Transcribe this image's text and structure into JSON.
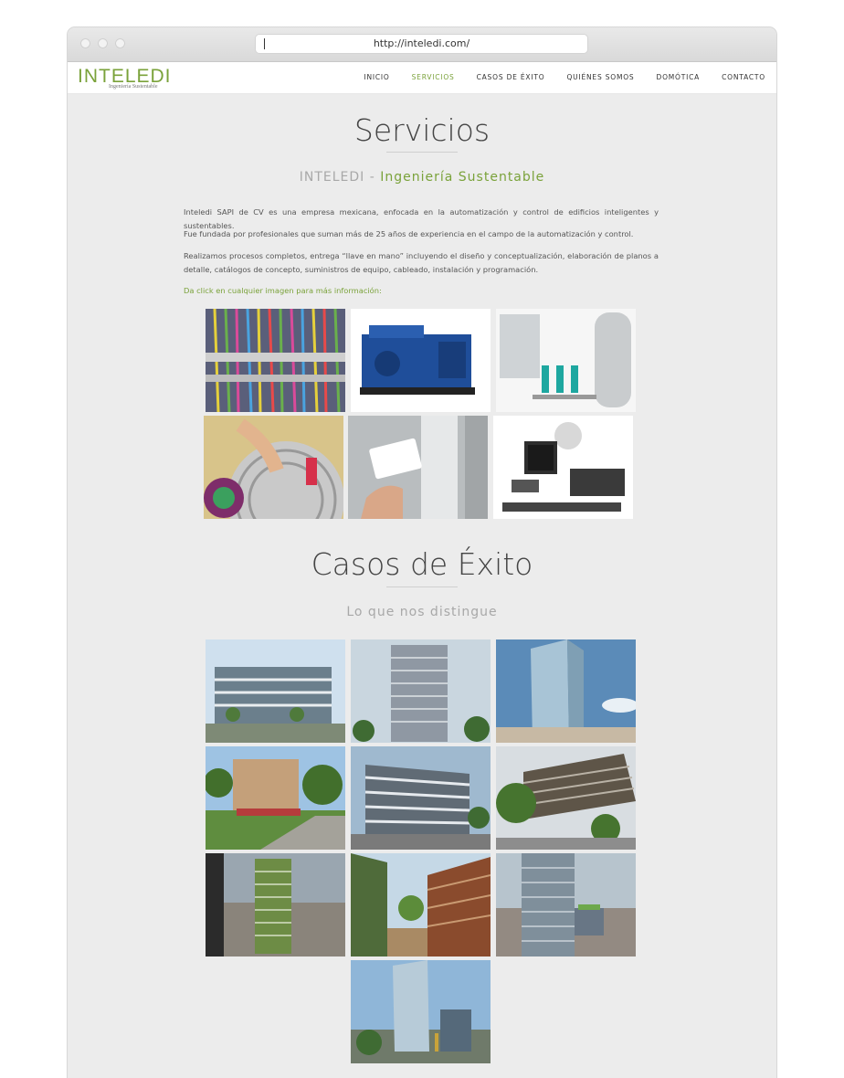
{
  "browser": {
    "url": "http://inteledi.com/"
  },
  "header": {
    "logo": "INTELEDI",
    "logo_tagline": "Ingeniería Sustentable",
    "menu": [
      "INICIO",
      "SERVICIOS",
      "CASOS DE ÉXITO",
      "QUIÉNES SOMOS",
      "DOMÓTICA",
      "CONTACTO"
    ],
    "active_menu": "SERVICIOS"
  },
  "servicios": {
    "title": "Servicios",
    "subtitle_gray": "INTELEDI -",
    "subtitle_green": "Ingeniería Sustentable",
    "paragraphs": [
      "Inteledi SAPI de CV es una empresa mexicana, enfocada en la automatización y control de edificios inteligentes y sustentables.",
      "Fue fundada por profesionales que suman más de 25 años de experiencia en el campo de la automatización y control.",
      "Realizamos procesos completos, entrega “llave en mano” incluyendo el diseño y conceptualización, elaboración de planos a detalle, catálogos de concepto, suministros de equipo, cableado, instalación y programación."
    ],
    "hint": "Da click en cualquier imagen para más información:",
    "images": [
      "network-cabling",
      "power-generator",
      "water-pump-system",
      "hvac-service",
      "access-card-reader",
      "security-camera-system"
    ]
  },
  "casos": {
    "title": "Casos de Éxito",
    "subtitle": "Lo que nos distingue",
    "images": [
      "building-1",
      "building-2",
      "building-3",
      "building-4",
      "building-5",
      "building-6",
      "building-7",
      "building-8",
      "building-9",
      "building-10"
    ]
  },
  "colors": {
    "accent": "#7aa23a",
    "page_bg": "#ececec",
    "text": "#555555"
  }
}
